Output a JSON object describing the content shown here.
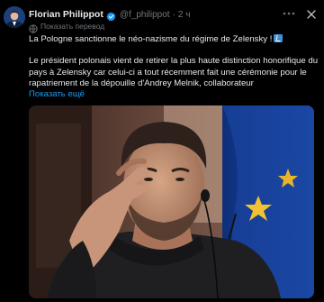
{
  "post": {
    "author_name": "Florian Philippot",
    "handle": "@f_philippot",
    "separator": "·",
    "time": "2 ч",
    "translate_label": "Показать перевод",
    "line1": "La Pologne sanctionne le néo-nazisme du régime de Zelensky !",
    "line2": "Le président polonais vient de retirer la plus haute distinction honorifique du pays à Zelensky car celui-ci a tout récemment fait une cérémonie pour le rapatriement de la dépouille d'Andrey Melnik, collaborateur",
    "show_more": "Показать ещё",
    "media_alt": "photo",
    "icons": {
      "more": "more-dots-icon",
      "close": "close-icon",
      "verified": "verified-badge-icon",
      "translate": "translate-icon",
      "flag": "check-box-emoji"
    }
  },
  "colors": {
    "background": "#000000",
    "text": "#e7e9ea",
    "muted": "#71767b",
    "link": "#1d9bf0",
    "verified": "#1d9bf0"
  }
}
